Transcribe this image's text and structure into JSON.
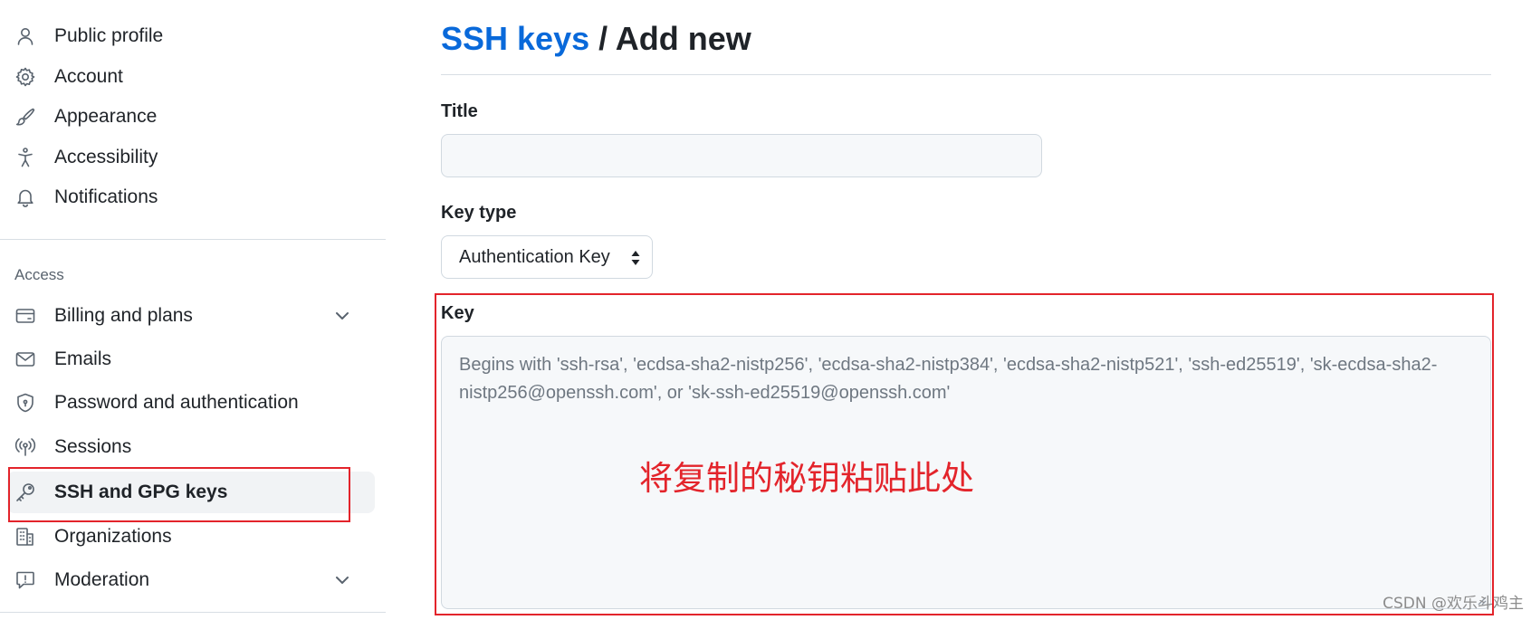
{
  "sidebar": {
    "items": [
      {
        "label": "Public profile",
        "icon": "person-icon"
      },
      {
        "label": "Account",
        "icon": "gear-icon"
      },
      {
        "label": "Appearance",
        "icon": "paintbrush-icon"
      },
      {
        "label": "Accessibility",
        "icon": "accessibility-icon"
      },
      {
        "label": "Notifications",
        "icon": "bell-icon"
      }
    ],
    "access_heading": "Access",
    "access_items": [
      {
        "label": "Billing and plans",
        "icon": "credit-card-icon",
        "expandable": true
      },
      {
        "label": "Emails",
        "icon": "mail-icon"
      },
      {
        "label": "Password and authentication",
        "icon": "shield-lock-icon"
      },
      {
        "label": "Sessions",
        "icon": "broadcast-icon"
      },
      {
        "label": "SSH and GPG keys",
        "icon": "key-icon",
        "selected": true
      },
      {
        "label": "Organizations",
        "icon": "organization-icon"
      },
      {
        "label": "Moderation",
        "icon": "report-icon",
        "expandable": true
      }
    ]
  },
  "main": {
    "breadcrumb_link": "SSH keys",
    "breadcrumb_separator": " / ",
    "breadcrumb_current": "Add new",
    "title_label": "Title",
    "title_value": "",
    "key_type_label": "Key type",
    "key_type_value": "Authentication Key",
    "key_label": "Key",
    "key_placeholder": "Begins with 'ssh-rsa', 'ecdsa-sha2-nistp256', 'ecdsa-sha2-nistp384', 'ecdsa-sha2-nistp521', 'ssh-ed25519', 'sk-ecdsa-sha2-nistp256@openssh.com', or 'sk-ssh-ed25519@openssh.com'",
    "annotation": "将复制的秘钥粘贴此处"
  },
  "watermark": "CSDN @欢乐斗鸡主",
  "colors": {
    "link": "#0969da",
    "annotation_red": "#e3242b",
    "selected_bg": "#f1f3f5"
  }
}
